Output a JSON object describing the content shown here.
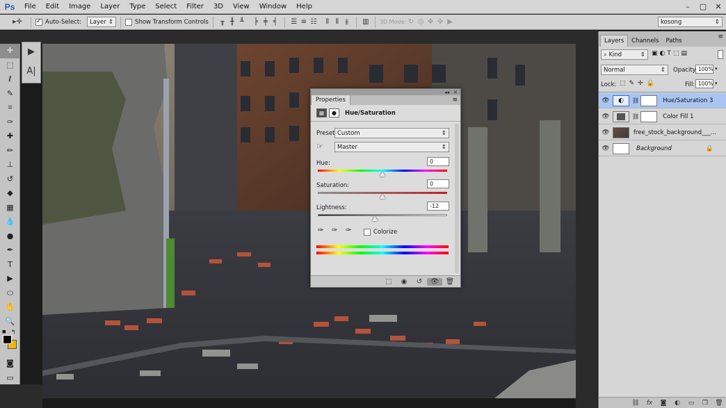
{
  "app": {
    "logo": "Ps"
  },
  "menu": [
    "File",
    "Edit",
    "Image",
    "Layer",
    "Type",
    "Select",
    "Filter",
    "3D",
    "View",
    "Window",
    "Help"
  ],
  "window_controls": [
    "–",
    "▢",
    "✕"
  ],
  "options": {
    "move_icon": "▸✛",
    "auto_select_label": "Auto-Select:",
    "auto_select_checked": true,
    "auto_select_target": "Layer",
    "transform_label": "Show Transform Controls",
    "transform_checked": false,
    "mode_label": "3D Mode:",
    "workspace": "kosong"
  },
  "tools": [
    "move-tool",
    "marquee-tool",
    "lasso-tool",
    "quick-selection-tool",
    "crop-tool",
    "eyedropper-tool",
    "healing-brush-tool",
    "brush-tool",
    "clone-stamp-tool",
    "history-brush-tool",
    "eraser-tool",
    "gradient-tool",
    "blur-tool",
    "dodge-tool",
    "pen-tool",
    "type-tool",
    "path-selection-tool",
    "shape-tool",
    "hand-tool",
    "zoom-tool"
  ],
  "tool_glyphs": [
    "✛",
    "⬚",
    "ℓ",
    "✎",
    "⌗",
    "✑",
    "✚",
    "✏",
    "⊥",
    "↺",
    "◆",
    "▦",
    "💧",
    "●",
    "✒",
    "T",
    "▶",
    "⬭",
    "✋",
    "🔍"
  ],
  "colors": {
    "foreground": "#000000",
    "background": "#f7b500"
  },
  "panel_strip": [
    "▶",
    "A|"
  ],
  "properties": {
    "title": "Properties",
    "type_label": "Hue/Saturation",
    "preset_label": "Preset:",
    "preset_value": "Custom",
    "channel_value": "Master",
    "hue_label": "Hue:",
    "hue_value": "0",
    "saturation_label": "Saturation:",
    "saturation_value": "0",
    "lightness_label": "Lightness:",
    "lightness_value": "-12",
    "colorize_label": "Colorize",
    "colorize_checked": false,
    "footer_icons": [
      "clip-to-layer-icon",
      "view-previous-state-icon",
      "reset-icon",
      "visibility-eye-icon",
      "trash-icon"
    ]
  },
  "layers_panel": {
    "tabs": [
      "Layers",
      "Channels",
      "Paths"
    ],
    "filter_kind": "Kind",
    "blend_mode": "Normal",
    "opacity_label": "Opacity:",
    "opacity_value": "100%",
    "lock_label": "Lock:",
    "fill_label": "Fill:",
    "fill_value": "100%",
    "layers": [
      {
        "name": "Hue/Saturation 3",
        "selected": true,
        "italic": false
      },
      {
        "name": "Color Fill 1",
        "selected": false,
        "italic": false
      },
      {
        "name": "free_stock_background___...",
        "selected": false,
        "italic": false
      },
      {
        "name": "Background",
        "selected": false,
        "italic": true,
        "locked": true
      }
    ],
    "bottom_icons": [
      "link-icon",
      "fx-icon",
      "mask-icon",
      "adjustment-icon",
      "folder-icon",
      "new-layer-icon",
      "trash-icon"
    ]
  }
}
